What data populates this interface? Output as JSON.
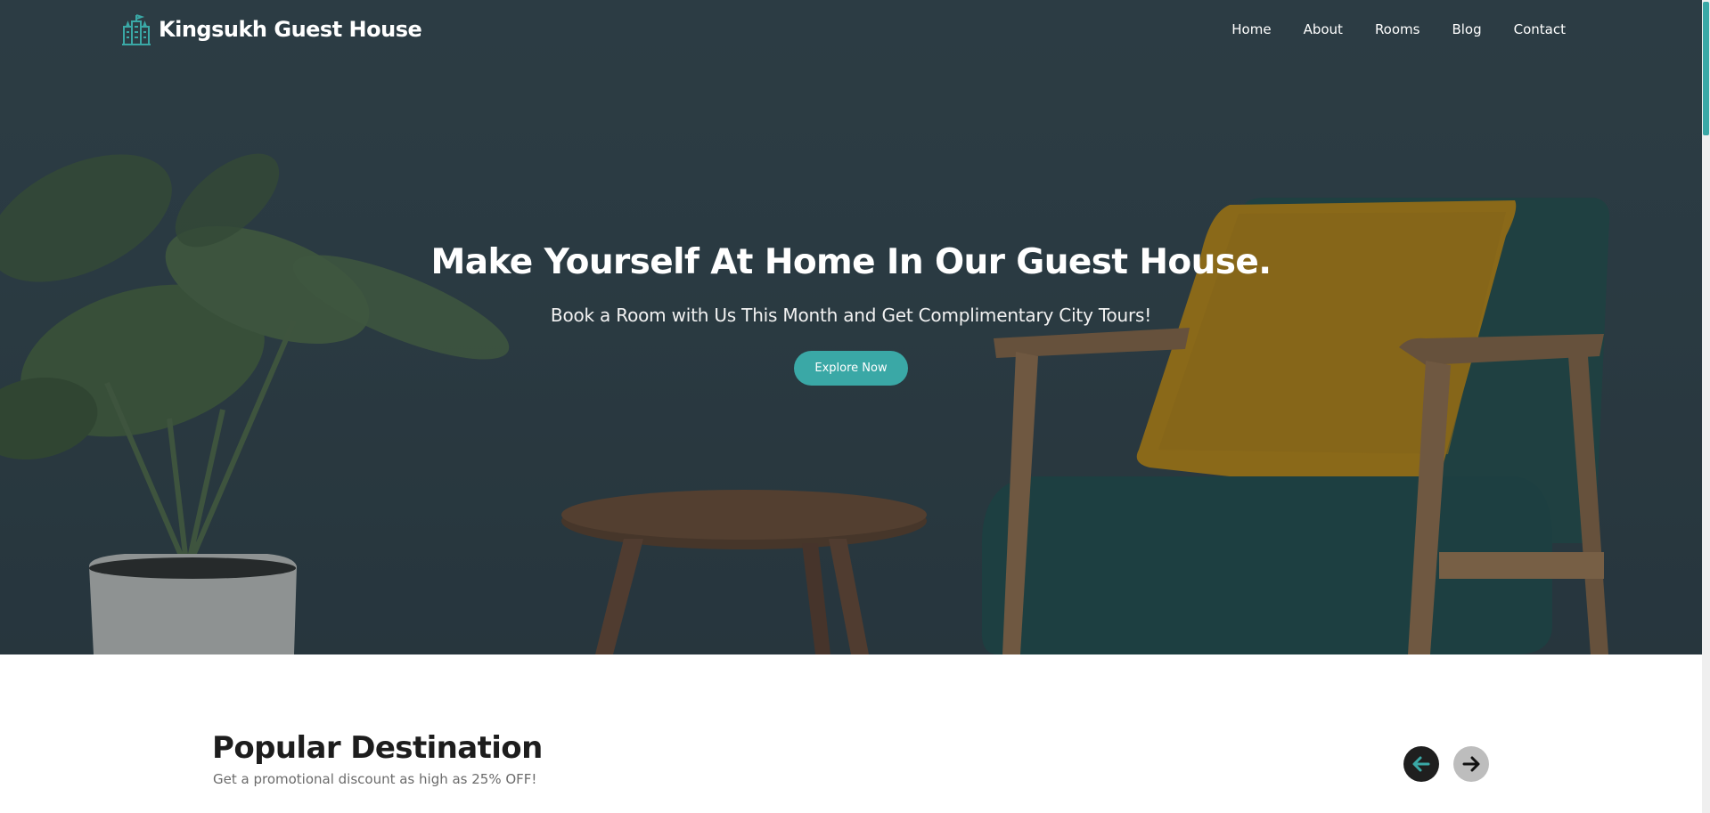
{
  "brand": {
    "name": "Kingsukh Guest House",
    "logo_icon": "guest-house-logo-icon"
  },
  "nav": {
    "items": [
      "Home",
      "About",
      "Rooms",
      "Blog",
      "Contact"
    ]
  },
  "hero": {
    "title": "Make Yourself At Home In Our Guest House.",
    "subtitle": "Book a Room with Us This Month and Get Complimentary City Tours!",
    "cta_label": "Explore Now"
  },
  "popular": {
    "title": "Popular Destination",
    "subtitle": "Get a promotional discount as high as 25% OFF!",
    "prev_icon": "arrow-left-icon",
    "next_icon": "arrow-right-icon"
  },
  "colors": {
    "accent": "#3aa8a6",
    "hero_bg": "#31434c",
    "dark": "#1f1f1f"
  }
}
